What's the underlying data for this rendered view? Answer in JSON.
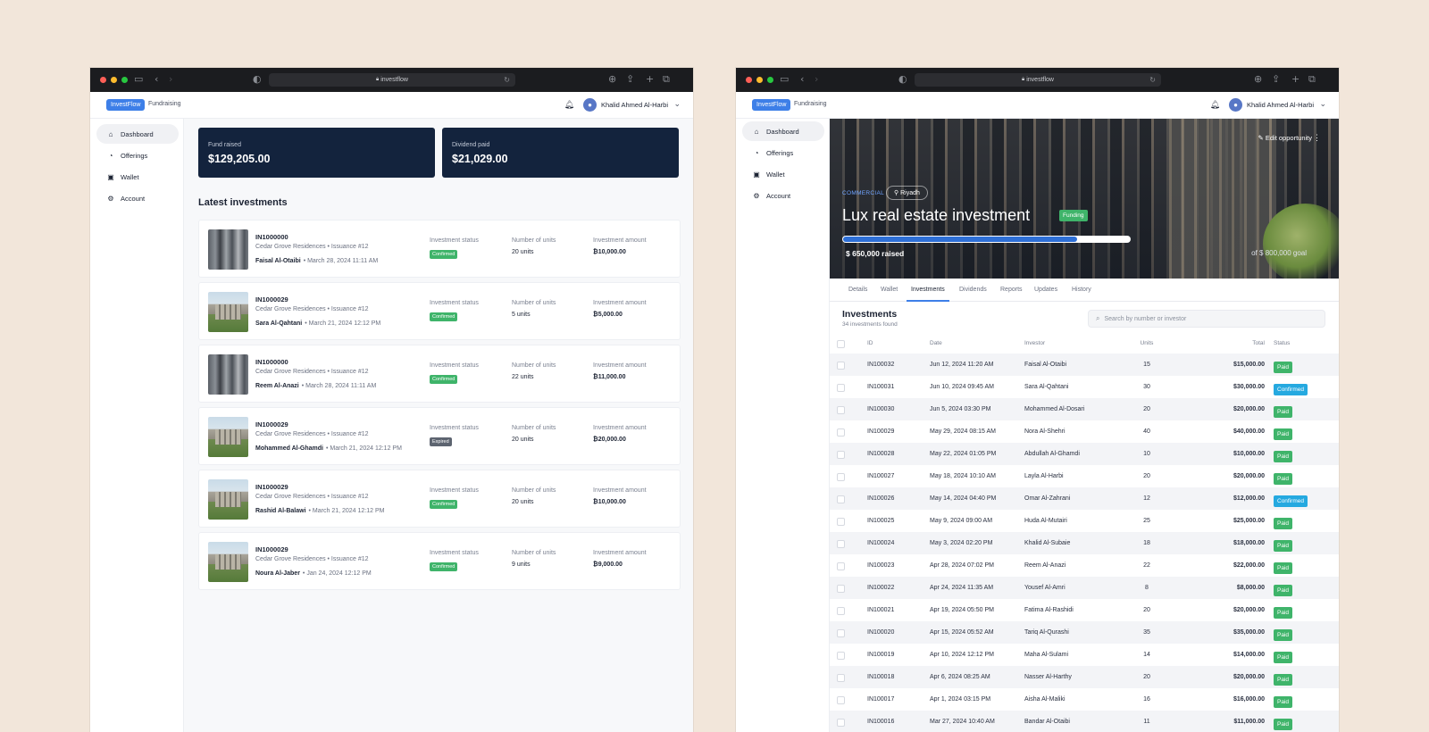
{
  "browser": {
    "url": "investflow"
  },
  "app": {
    "brand": "InvestFlow",
    "section": "Fundraising",
    "user_name": "Khalid Ahmed Al-Harbi"
  },
  "sidebar": {
    "items": [
      {
        "label": "Dashboard",
        "icon": "home-icon"
      },
      {
        "label": "Offerings",
        "icon": "pie-chart-icon"
      },
      {
        "label": "Wallet",
        "icon": "wallet-icon"
      },
      {
        "label": "Account",
        "icon": "gear-icon"
      }
    ]
  },
  "dashboard": {
    "stats": [
      {
        "label": "Fund raised",
        "value": "$129,205.00"
      },
      {
        "label": "Dividend paid",
        "value": "$21,029.00"
      }
    ],
    "latest_title": "Latest investments",
    "col_status": "Investment status",
    "col_units": "Number of units",
    "col_amount": "Investment amount",
    "investments": [
      {
        "id": "IN1000000",
        "property": "Cedar Grove Residences • Issuance #12",
        "investor": "Faisal Al-Otaibi",
        "date": "• March 28, 2024 11:11 AM",
        "status": "Confirmed",
        "units": "20 units",
        "amount": "₿10,000.00",
        "thumb": "t1"
      },
      {
        "id": "IN1000029",
        "property": "Cedar Grove Residences • Issuance #12",
        "investor": "Sara Al-Qahtani",
        "date": "• March 21, 2024 12:12 PM",
        "status": "Confirmed",
        "units": "5 units",
        "amount": "₿5,000.00",
        "thumb": "t2"
      },
      {
        "id": "IN1000000",
        "property": "Cedar Grove Residences • Issuance #12",
        "investor": "Reem Al-Anazi",
        "date": "• March 28, 2024 11:11 AM",
        "status": "Confirmed",
        "units": "22 units",
        "amount": "₿11,000.00",
        "thumb": "t1"
      },
      {
        "id": "IN1000029",
        "property": "Cedar Grove Residences • Issuance #12",
        "investor": "Mohammed Al-Ghamdi",
        "date": "• March 21, 2024 12:12 PM",
        "status": "Expired",
        "units": "20 units",
        "amount": "₿20,000.00",
        "thumb": "t2"
      },
      {
        "id": "IN1000029",
        "property": "Cedar Grove Residences • Issuance #12",
        "investor": "Rashid Al-Balawi",
        "date": "• March 21, 2024 12:12 PM",
        "status": "Confirmed",
        "units": "20 units",
        "amount": "₿10,000.00",
        "thumb": "t2"
      },
      {
        "id": "IN1000029",
        "property": "Cedar Grove Residences • Issuance #12",
        "investor": "Noura Al-Jaber",
        "date": "• Jan 24, 2024 12:12 PM",
        "status": "Confirmed",
        "units": "9 units",
        "amount": "₿9,000.00",
        "thumb": "t2"
      }
    ]
  },
  "opportunity": {
    "edit_label": "Edit opportunity",
    "category": "COMMERCIAL",
    "location": "Riyadh",
    "title": "Lux real estate investment",
    "status_badge": "Funding",
    "raised": "$ 650,000 raised",
    "goal": "of $ 800,000 goal",
    "progress_fraction": 0.8125,
    "tabs": [
      "Details",
      "Wallet",
      "Investments",
      "Dividends",
      "Reports",
      "Updates",
      "History"
    ],
    "active_tab": "Investments",
    "investments_title": "Investments",
    "investments_count": "34 investments found",
    "search_placeholder": "Search by number or investor",
    "columns": {
      "id": "ID",
      "date": "Date",
      "investor": "Investor",
      "units": "Units",
      "total": "Total",
      "status": "Status"
    },
    "rows": [
      {
        "id": "IN100032",
        "date": "Jun 12, 2024 11:20 AM",
        "investor": "Faisal Al-Otaibi",
        "units": "15",
        "total": "$15,000.00",
        "status": "Paid"
      },
      {
        "id": "IN100031",
        "date": "Jun 10, 2024 09:45 AM",
        "investor": "Sara Al-Qahtani",
        "units": "30",
        "total": "$30,000.00",
        "status": "Confirmed"
      },
      {
        "id": "IN100030",
        "date": "Jun 5, 2024 03:30 PM",
        "investor": "Mohammed Al-Dosari",
        "units": "20",
        "total": "$20,000.00",
        "status": "Paid"
      },
      {
        "id": "IN100029",
        "date": "May 29, 2024 08:15 AM",
        "investor": "Nora Al-Shehri",
        "units": "40",
        "total": "$40,000.00",
        "status": "Paid"
      },
      {
        "id": "IN100028",
        "date": "May 22, 2024 01:05 PM",
        "investor": "Abdullah Al-Ghamdi",
        "units": "10",
        "total": "$10,000.00",
        "status": "Paid"
      },
      {
        "id": "IN100027",
        "date": "May 18, 2024 10:10 AM",
        "investor": "Layla Al-Harbi",
        "units": "20",
        "total": "$20,000.00",
        "status": "Paid"
      },
      {
        "id": "IN100026",
        "date": "May 14, 2024 04:40 PM",
        "investor": "Omar Al-Zahrani",
        "units": "12",
        "total": "$12,000.00",
        "status": "Confirmed"
      },
      {
        "id": "IN100025",
        "date": "May 9, 2024 09:00 AM",
        "investor": "Huda Al-Mutairi",
        "units": "25",
        "total": "$25,000.00",
        "status": "Paid"
      },
      {
        "id": "IN100024",
        "date": "May 3, 2024 02:20 PM",
        "investor": "Khalid Al-Subaie",
        "units": "18",
        "total": "$18,000.00",
        "status": "Paid"
      },
      {
        "id": "IN100023",
        "date": "Apr 28, 2024 07:02 PM",
        "investor": "Reem Al-Anazi",
        "units": "22",
        "total": "$22,000.00",
        "status": "Paid"
      },
      {
        "id": "IN100022",
        "date": "Apr 24, 2024 11:35 AM",
        "investor": "Yousef Al-Amri",
        "units": "8",
        "total": "$8,000.00",
        "status": "Paid"
      },
      {
        "id": "IN100021",
        "date": "Apr 19, 2024 05:50 PM",
        "investor": "Fatima Al-Rashidi",
        "units": "20",
        "total": "$20,000.00",
        "status": "Paid"
      },
      {
        "id": "IN100020",
        "date": "Apr 15, 2024 05:52 AM",
        "investor": "Tariq Al-Qurashi",
        "units": "35",
        "total": "$35,000.00",
        "status": "Paid"
      },
      {
        "id": "IN100019",
        "date": "Apr 10, 2024 12:12 PM",
        "investor": "Maha Al-Sulami",
        "units": "14",
        "total": "$14,000.00",
        "status": "Paid"
      },
      {
        "id": "IN100018",
        "date": "Apr 6, 2024 08:25 AM",
        "investor": "Nasser Al-Harthy",
        "units": "20",
        "total": "$20,000.00",
        "status": "Paid"
      },
      {
        "id": "IN100017",
        "date": "Apr 1, 2024 03:15 PM",
        "investor": "Aisha Al-Maliki",
        "units": "16",
        "total": "$16,000.00",
        "status": "Paid"
      },
      {
        "id": "IN100016",
        "date": "Mar 27, 2024 10:40 AM",
        "investor": "Bandar Al-Otaibi",
        "units": "11",
        "total": "$11,000.00",
        "status": "Paid"
      }
    ]
  }
}
